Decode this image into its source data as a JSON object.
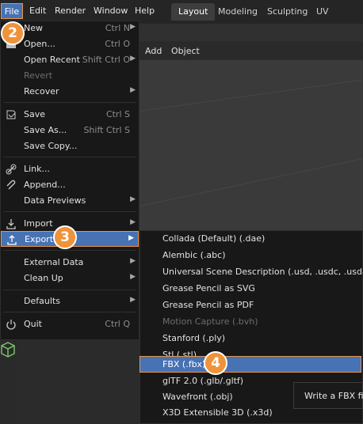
{
  "menubar": {
    "file": "File",
    "edit": "Edit",
    "render": "Render",
    "window": "Window",
    "help": "Help"
  },
  "workspaces": [
    "Layout",
    "Modeling",
    "Sculpting",
    "UV Editing"
  ],
  "viewport_header": {
    "add": "Add",
    "object": "Object"
  },
  "file_menu": {
    "new": {
      "label": "New",
      "shortcut": "Ctrl N"
    },
    "open": {
      "label": "Open...",
      "shortcut": "Ctrl O"
    },
    "open_recent": {
      "label": "Open Recent",
      "shortcut": "Shift Ctrl O"
    },
    "revert": {
      "label": "Revert"
    },
    "recover": {
      "label": "Recover"
    },
    "save": {
      "label": "Save",
      "shortcut": "Ctrl S"
    },
    "save_as": {
      "label": "Save As...",
      "shortcut": "Shift Ctrl S"
    },
    "save_copy": {
      "label": "Save Copy..."
    },
    "link": {
      "label": "Link..."
    },
    "append": {
      "label": "Append..."
    },
    "data_previews": {
      "label": "Data Previews"
    },
    "import": {
      "label": "Import"
    },
    "export": {
      "label": "Export"
    },
    "external_data": {
      "label": "External Data"
    },
    "clean_up": {
      "label": "Clean Up"
    },
    "defaults": {
      "label": "Defaults"
    },
    "quit": {
      "label": "Quit",
      "shortcut": "Ctrl Q"
    }
  },
  "export_menu": [
    "Collada (Default) (.dae)",
    "Alembic (.abc)",
    "Universal Scene Description (.usd, .usdc, .usda)",
    "Grease Pencil as SVG",
    "Grease Pencil as PDF",
    "Motion Capture (.bvh)",
    "Stanford (.ply)",
    "Stl (.stl)",
    "FBX (.fbx)",
    "glTF 2.0 (.glb/.gltf)",
    "Wavefront (.obj)",
    "X3D Extensible 3D (.x3d)"
  ],
  "tooltip": "Write a FBX file.",
  "step_badges": [
    "2",
    "3",
    "4"
  ],
  "colors": {
    "highlight": "#4772b3",
    "callout": "#f0923a"
  }
}
